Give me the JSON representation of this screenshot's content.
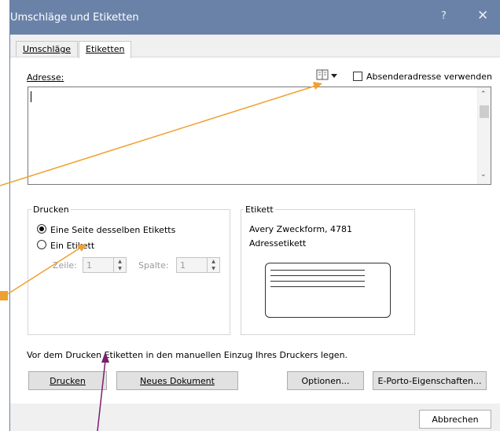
{
  "window": {
    "title": "Umschläge und Etiketten",
    "help": "?",
    "close": "✕"
  },
  "tabs": [
    {
      "label": "Umschläge"
    },
    {
      "label": "Etiketten"
    }
  ],
  "address": {
    "label": "Adresse:",
    "return_address_checkbox": "Absenderadresse verwenden",
    "value": ""
  },
  "print": {
    "legend": "Drucken",
    "full_page": "Eine Seite desselben Etiketts",
    "single_label": "Ein Etikett",
    "row_label": "Zeile:",
    "row_value": "1",
    "col_label": "Spalte:",
    "col_value": "1"
  },
  "label": {
    "legend": "Etikett",
    "vendor": "Avery Zweckform, 4781",
    "type": "Adressetikett"
  },
  "instruction": "Vor dem Drucken Etiketten in den manuellen Einzug Ihres Druckers legen.",
  "buttons": {
    "print": "Drucken",
    "new_doc": "Neues Dokument",
    "options": "Optionen...",
    "eporto": "E-Porto-Eigenschaften...",
    "cancel": "Abbrechen"
  },
  "colors": {
    "titlebar": "#6b82a8",
    "annotation_orange": "#f0a030",
    "annotation_purple": "#7a1f6e"
  }
}
